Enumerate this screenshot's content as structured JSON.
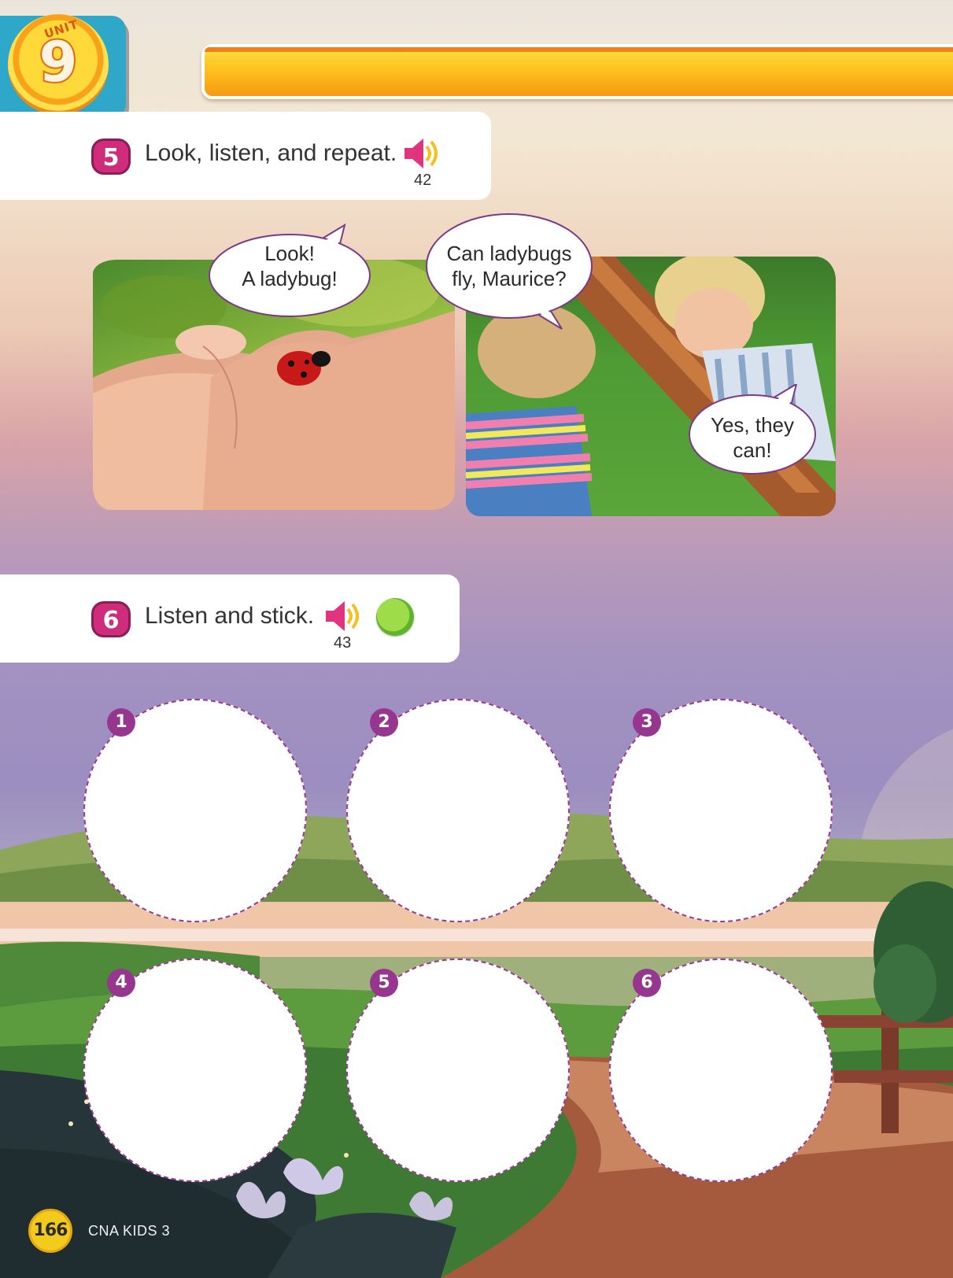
{
  "unit": {
    "label": "UNIT",
    "number": "9"
  },
  "exercise5": {
    "number": "5",
    "instruction": "Look, listen, and repeat.",
    "audio_track": "42",
    "icon": "speaker-icon"
  },
  "dialogue": {
    "bubble1_line1": "Look!",
    "bubble1_line2": "A ladybug!",
    "bubble2_line1": "Can ladybugs",
    "bubble2_line2": "fly, Maurice?",
    "bubble3_line1": "Yes, they",
    "bubble3_line2": "can!"
  },
  "exercise6": {
    "number": "6",
    "instruction": "Listen and stick.",
    "audio_track": "43",
    "icons": [
      "speaker-icon",
      "sticker-icon"
    ]
  },
  "sticker_slots": [
    "1",
    "2",
    "3",
    "4",
    "5",
    "6"
  ],
  "footer": {
    "page_number": "166",
    "book_title": "CNA KIDS 3"
  },
  "colors": {
    "accent_magenta": "#cf2c7c",
    "slot_purple": "#96368f",
    "banner_orange": "#f59a12",
    "page_badge_yellow": "#f2cb1c"
  }
}
